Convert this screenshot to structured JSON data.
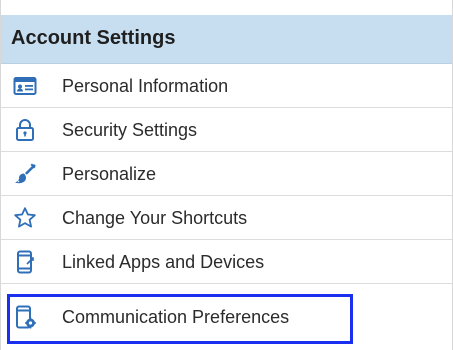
{
  "panel": {
    "title": "Account Settings",
    "items": [
      {
        "label": "Personal Information",
        "icon": "id-card-icon"
      },
      {
        "label": "Security Settings",
        "icon": "lock-icon"
      },
      {
        "label": "Personalize",
        "icon": "paintbrush-icon"
      },
      {
        "label": "Change Your Shortcuts",
        "icon": "star-icon"
      },
      {
        "label": "Linked Apps and Devices",
        "icon": "mobile-link-icon"
      },
      {
        "label": "Communication Preferences",
        "icon": "mobile-gear-icon"
      }
    ],
    "selected_item": "Communication Preferences"
  },
  "colors": {
    "header_bg": "#c7def1",
    "icon_blue": "#2f6fb8",
    "selection_outline": "#1a2ff0"
  }
}
